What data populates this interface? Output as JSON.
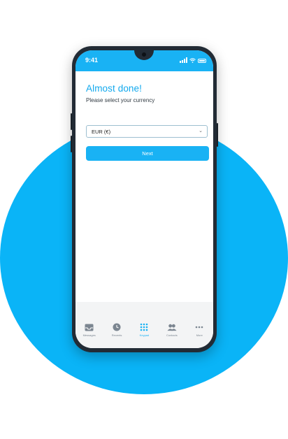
{
  "status_bar": {
    "time": "9:41"
  },
  "page": {
    "title": "Almost done!",
    "subtitle": "Please select your currency"
  },
  "currency_select": {
    "selected_value": "EUR (€)"
  },
  "next_button": {
    "label": "Next"
  },
  "tab_bar": {
    "tabs": [
      {
        "label": "Messages",
        "icon": "inbox-icon",
        "active": false
      },
      {
        "label": "Recents",
        "icon": "clock-icon",
        "active": false
      },
      {
        "label": "Keypad",
        "icon": "keypad-icon",
        "active": true
      },
      {
        "label": "Contacts",
        "icon": "contacts-icon",
        "active": false
      },
      {
        "label": "More",
        "icon": "more-icon",
        "active": false
      }
    ]
  },
  "colors": {
    "accent": "#19b2f4",
    "background_circle": "#0ab4f7",
    "phone_frame": "#222b35"
  }
}
